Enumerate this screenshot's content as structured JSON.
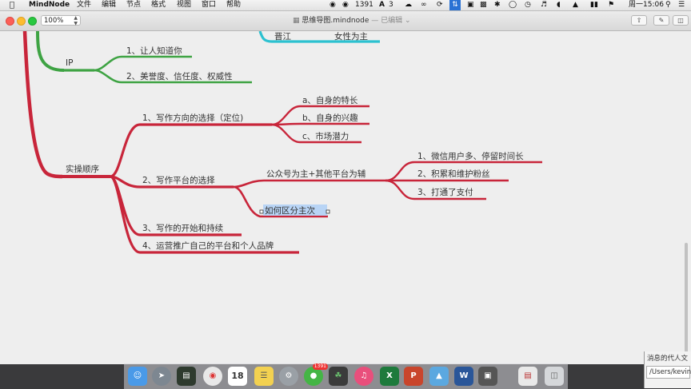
{
  "menubar": {
    "app_name": "MindNode",
    "menus": [
      "文件",
      "编辑",
      "节点",
      "格式",
      "视图",
      "窗口",
      "帮助"
    ],
    "status": {
      "wechat_count": "1391",
      "input_count": "3",
      "clock": "周一15:06"
    }
  },
  "window": {
    "zoom": "100%",
    "filename": "思维导图.mindnode",
    "edited_label": "— 已编辑"
  },
  "mindmap": {
    "top_partial": {
      "left": "晋江",
      "right": "女性为主"
    },
    "ip": {
      "label": "IP",
      "children": [
        "1、让人知道你",
        "2、美誉度、信任度、权威性"
      ]
    },
    "shixu": {
      "label": "实操顺序",
      "c1": {
        "label": "1、写作方向的选择（定位)",
        "children": [
          "a、自身的特长",
          "b、自身的兴趣",
          "c、市场潜力"
        ]
      },
      "c2": {
        "label": "2、写作平台的选择",
        "sub": {
          "label": "公众号为主+其他平台为辅",
          "children": [
            "1、微信用户多、停留时间长",
            "2、积累和维护粉丝",
            "3、打通了支付"
          ]
        },
        "sub2": "如何区分主次"
      },
      "c3": "3、写作的开始和持续",
      "c4": "4、运营推广自己的平台和个人品牌"
    },
    "colors": {
      "red": "#c8253a",
      "green": "#3ea343",
      "cyan": "#2cc1d0",
      "select": "#b8d4f5"
    }
  },
  "dock": {
    "calendar_day": "18",
    "mail_badge": "1391"
  },
  "terminal": {
    "line1": "消息的代人文",
    "line2": "/Users/kevinhe"
  }
}
